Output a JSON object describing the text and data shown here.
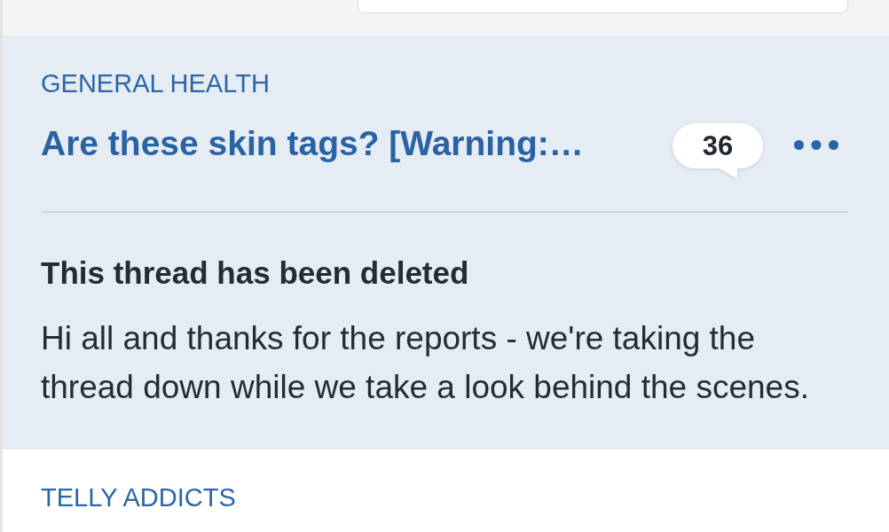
{
  "threads": [
    {
      "category": "GENERAL HEALTH",
      "title": "Are these skin tags? [Warning:…",
      "comment_count": "36",
      "deleted": true,
      "notice": {
        "heading": "This thread has been deleted",
        "message": "Hi all and thanks for the reports - we're taking the thread down while we take a look behind the scenes."
      }
    },
    {
      "category": "TELLY ADDICTS",
      "deleted": false
    }
  ]
}
